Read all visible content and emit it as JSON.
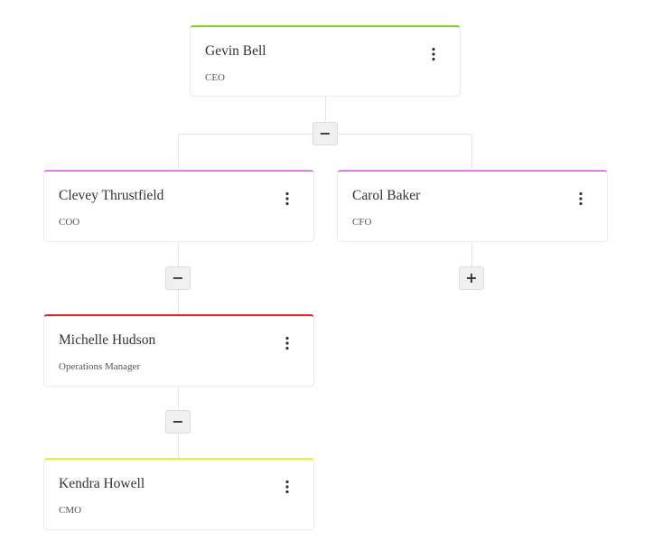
{
  "nodes": [
    {
      "id": "gevin",
      "name": "Gevin Bell",
      "title": "CEO",
      "accent": "#7ed321",
      "menu_icon": "vertical-ellipsis-icon"
    },
    {
      "id": "clevey",
      "name": "Clevey Thrustfield",
      "title": "COO",
      "accent": "#d97fe6",
      "menu_icon": "vertical-ellipsis-icon"
    },
    {
      "id": "carol",
      "name": "Carol Baker",
      "title": "CFO",
      "accent": "#d97fe6",
      "menu_icon": "vertical-ellipsis-icon"
    },
    {
      "id": "michelle",
      "name": "Michelle Hudson",
      "title": "Operations Manager",
      "accent": "#e02020",
      "menu_icon": "vertical-ellipsis-icon"
    },
    {
      "id": "kendra",
      "name": "Kendra Howell",
      "title": "CMO",
      "accent": "#f2ee2a",
      "menu_icon": "vertical-ellipsis-icon"
    }
  ],
  "toggles": {
    "gevin": "−",
    "clevey": "−",
    "carol": "+",
    "michelle": "−"
  }
}
